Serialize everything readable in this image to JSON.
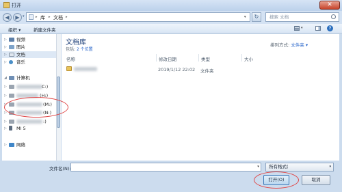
{
  "window": {
    "title": "打开"
  },
  "address": {
    "seg1": "库",
    "seg2": "文档",
    "search_placeholder": "搜索 文档"
  },
  "toolbar": {
    "organize": "组织 ▾",
    "new_folder": "新建文件夹"
  },
  "sidebar": {
    "items": [
      {
        "label": "视频",
        "icon": "video-library-icon"
      },
      {
        "label": "图片",
        "icon": "picture-library-icon"
      },
      {
        "label": "文档",
        "icon": "documents-library-icon"
      },
      {
        "label": "音乐",
        "icon": "music-library-icon"
      },
      {
        "label": "计算机",
        "icon": "computer-icon"
      },
      {
        "label": "C:)",
        "icon": "drive-icon"
      },
      {
        "label": "(H:)",
        "icon": "drive-icon"
      },
      {
        "label": "(M:)",
        "icon": "drive-icon"
      },
      {
        "label": "(N:)",
        "icon": "drive-icon"
      },
      {
        "label": ":)",
        "icon": "drive-icon"
      },
      {
        "label": "MI 5",
        "icon": "phone-icon"
      },
      {
        "label": "网络",
        "icon": "network-icon"
      }
    ]
  },
  "library": {
    "title": "文档库",
    "includes_prefix": "包括:",
    "includes_link": "2 个位置",
    "arrange_label": "排列方式:",
    "arrange_value": "文件夹 ▾"
  },
  "columns": {
    "name": "名称",
    "date": "修改日期",
    "type": "类型",
    "size": "大小"
  },
  "rows": [
    {
      "date": "2019/1/12 22:02",
      "type": "文件夹"
    }
  ],
  "footer": {
    "filename_label": "文件名(N):",
    "filter_label": "所有格式(",
    "open_button": "打开(O)",
    "cancel_button": "取消"
  },
  "colors": {
    "accent": "#1c3e78",
    "link": "#2563c9",
    "annotation": "#e04848"
  }
}
